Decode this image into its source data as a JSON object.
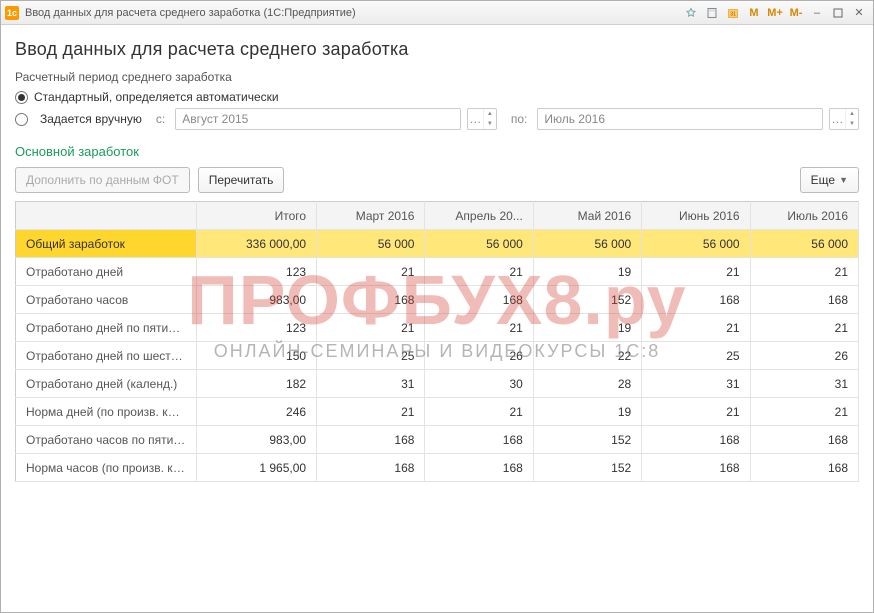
{
  "window": {
    "title": "Ввод данных для расчета среднего заработка  (1С:Предприятие)"
  },
  "page": {
    "heading": "Ввод данных для расчета среднего заработка",
    "period_label": "Расчетный период среднего заработка",
    "radio_auto": "Стандартный, определяется автоматически",
    "radio_manual": "Задается вручную",
    "from_lbl": "с:",
    "to_lbl": "по:",
    "date_from": "Август 2015",
    "date_to": "Июль 2016",
    "section": "Основной заработок"
  },
  "toolbar": {
    "fill_fot": "Дополнить по данным ФОТ",
    "recalc": "Перечитать",
    "more": "Еще"
  },
  "table": {
    "headers": [
      "",
      "Итого",
      "Март 2016",
      "Апрель 20...",
      "Май 2016",
      "Июнь 2016",
      "Июль 2016"
    ],
    "rows": [
      {
        "label": "Общий заработок",
        "values": [
          "336 000,00",
          "56 000",
          "56 000",
          "56 000",
          "56 000",
          "56 000"
        ],
        "highlight": true
      },
      {
        "label": "Отработано дней",
        "values": [
          "123",
          "21",
          "21",
          "19",
          "21",
          "21"
        ]
      },
      {
        "label": "Отработано часов",
        "values": [
          "983,00",
          "168",
          "168",
          "152",
          "168",
          "168"
        ]
      },
      {
        "label": "Отработано дней по пятидне...",
        "values": [
          "123",
          "21",
          "21",
          "19",
          "21",
          "21"
        ]
      },
      {
        "label": "Отработано дней по шестидн...",
        "values": [
          "150",
          "25",
          "26",
          "22",
          "25",
          "26"
        ]
      },
      {
        "label": "Отработано дней (календ.)",
        "values": [
          "182",
          "31",
          "30",
          "28",
          "31",
          "31"
        ]
      },
      {
        "label": "Норма дней (по произв. кале...",
        "values": [
          "246",
          "21",
          "21",
          "19",
          "21",
          "21"
        ]
      },
      {
        "label": "Отработано часов по пятидн...",
        "values": [
          "983,00",
          "168",
          "168",
          "152",
          "168",
          "168"
        ]
      },
      {
        "label": "Норма часов (по произв. кал...",
        "values": [
          "1 965,00",
          "168",
          "168",
          "152",
          "168",
          "168"
        ]
      }
    ]
  },
  "watermark": {
    "big": "ПРОФБУХ8.ру",
    "sub": "ОНЛАЙН-СЕМИНАРЫ И ВИДЕОКУРСЫ 1С:8"
  },
  "titlebar_buttons": {
    "m": "M",
    "mplus": "M+",
    "mminus": "M-"
  }
}
